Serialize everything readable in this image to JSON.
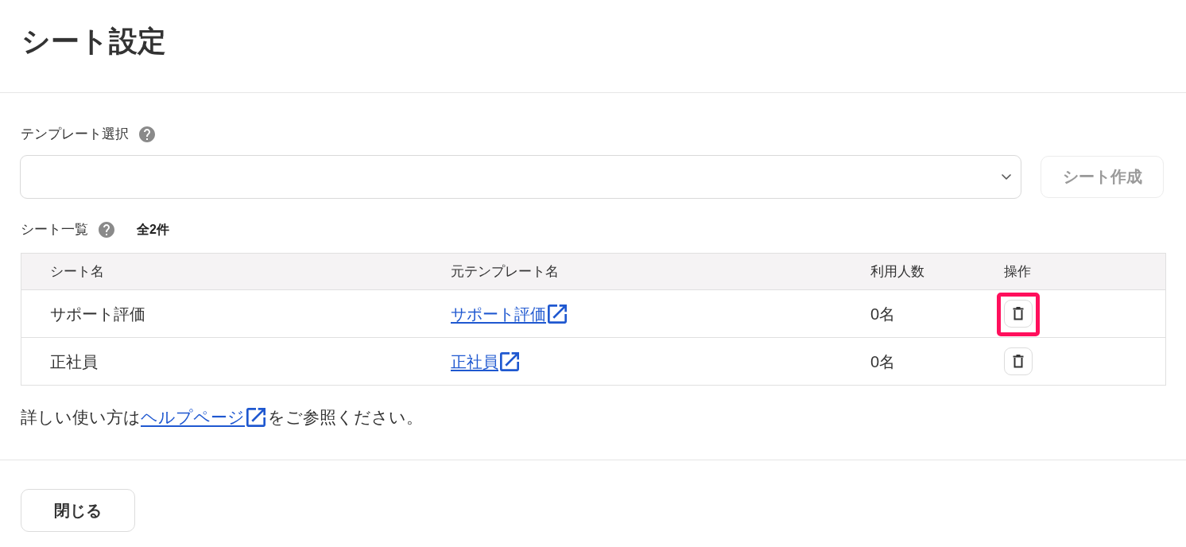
{
  "page": {
    "title": "シート設定"
  },
  "template_select": {
    "label": "テンプレート選択",
    "create_button": {
      "label": "シート作成",
      "disabled": true
    }
  },
  "sheet_list": {
    "label": "シート一覧",
    "count": "全2件"
  },
  "table": {
    "columns": [
      "シート名",
      "元テンプレート名",
      "利用人数",
      "操作"
    ],
    "rows": [
      {
        "sheet_name": "サポート評価",
        "template_name": "サポート評価",
        "users": "0名",
        "highlighted": true
      },
      {
        "sheet_name": "正社員",
        "template_name": "正社員",
        "users": "0名",
        "highlighted": false
      }
    ]
  },
  "help_text": {
    "before": "詳しい使い方は",
    "link": "ヘルプページ",
    "after": "をご参照ください。"
  },
  "footer": {
    "close_button": "閉じる"
  }
}
